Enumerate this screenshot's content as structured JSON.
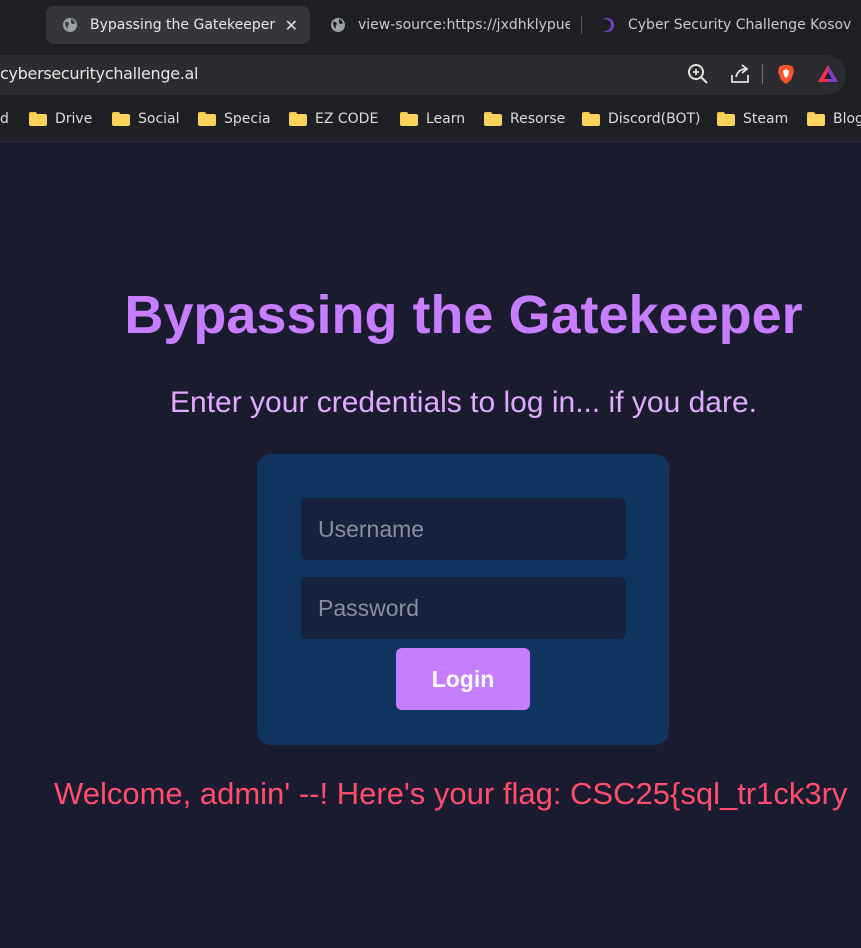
{
  "browser": {
    "tabs": [
      {
        "title": "Bypassing the Gatekeeper",
        "icon": "globe-icon",
        "active": true
      },
      {
        "title": "view-source:https://jxdhklypue-",
        "icon": "globe-icon",
        "active": false
      },
      {
        "title": "Cyber Security Challenge Kosov",
        "icon": "crescent-icon",
        "active": false
      }
    ],
    "close_glyph": "✕",
    "url": "cybersecuritychallenge.al",
    "toolbar_icons": [
      "zoom-icon",
      "share-icon",
      "brave-shield-icon",
      "brave-rewards-icon"
    ],
    "bookmarks": [
      "d",
      "Drive",
      "Social",
      "Specia",
      "EZ CODE",
      "Learn",
      "Resorse",
      "Discord(BOT)",
      "Steam",
      "Blog"
    ]
  },
  "page": {
    "title": "Bypassing the Gatekeeper",
    "subtitle": "Enter your credentials to log in... if you dare.",
    "form": {
      "username_placeholder": "Username",
      "password_placeholder": "Password",
      "login_label": "Login"
    },
    "flag_message": "Welcome, admin' --! Here's your flag: CSC25{sql_tr1ck3ry"
  },
  "colors": {
    "background": "#1b1b2f",
    "title": "#c77dff",
    "subtitle": "#e0aaff",
    "card": "#0f3460",
    "input": "#16213e",
    "button": "#c77dff",
    "flag": "#ff4d6d"
  }
}
